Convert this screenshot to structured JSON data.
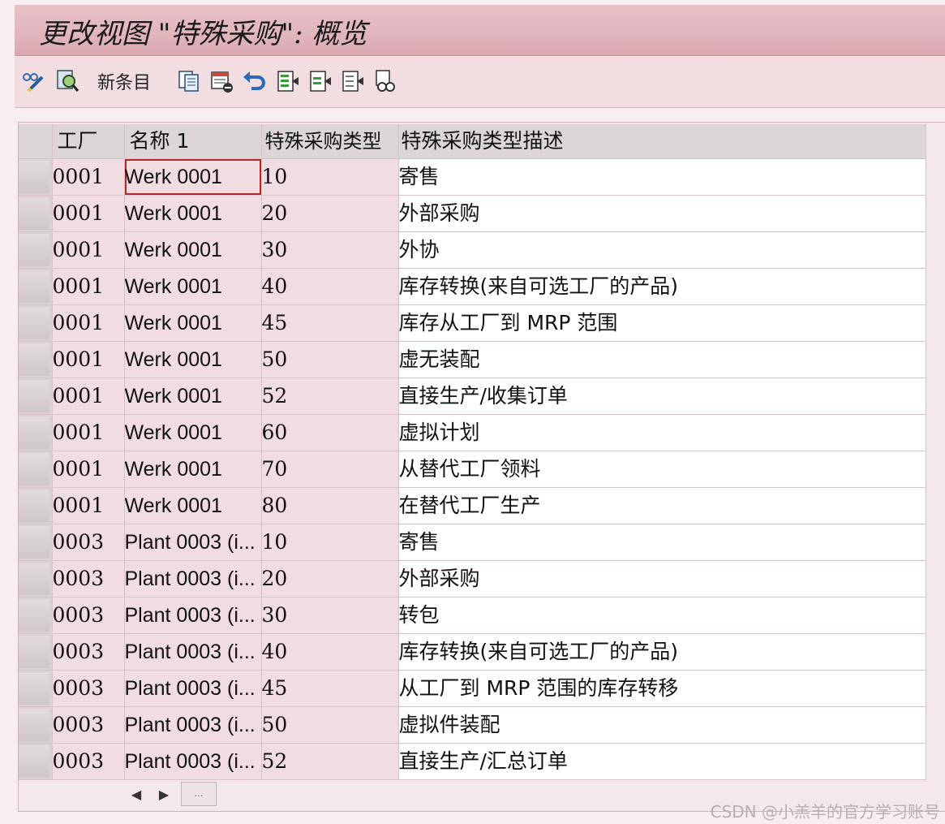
{
  "window": {
    "title": "更改视图 \"特殊采购\": 概览"
  },
  "toolbar": {
    "new_entry_label": "新条目",
    "icons": [
      "display-change-icon",
      "find-icon",
      "copy-icon",
      "delete-icon",
      "undo-icon",
      "select-all-icon",
      "select-block-icon",
      "deselect-all-icon",
      "print-icon"
    ]
  },
  "table": {
    "columns": [
      "工厂",
      "名称 1",
      "特殊采购类型",
      "特殊采购类型描述"
    ],
    "rows": [
      {
        "plant": "0001",
        "name": "Werk 0001",
        "type": "10",
        "desc": "寄售"
      },
      {
        "plant": "0001",
        "name": "Werk 0001",
        "type": "20",
        "desc": "外部采购"
      },
      {
        "plant": "0001",
        "name": "Werk 0001",
        "type": "30",
        "desc": "外协"
      },
      {
        "plant": "0001",
        "name": "Werk 0001",
        "type": "40",
        "desc": "库存转换(来自可选工厂的产品)"
      },
      {
        "plant": "0001",
        "name": "Werk 0001",
        "type": "45",
        "desc": "库存从工厂到 MRP 范围"
      },
      {
        "plant": "0001",
        "name": "Werk 0001",
        "type": "50",
        "desc": "虚无装配"
      },
      {
        "plant": "0001",
        "name": "Werk 0001",
        "type": "52",
        "desc": "直接生产/收集订单"
      },
      {
        "plant": "0001",
        "name": "Werk 0001",
        "type": "60",
        "desc": "虚拟计划"
      },
      {
        "plant": "0001",
        "name": "Werk 0001",
        "type": "70",
        "desc": "从替代工厂领料"
      },
      {
        "plant": "0001",
        "name": "Werk 0001",
        "type": "80",
        "desc": "在替代工厂生产"
      },
      {
        "plant": "0003",
        "name": "Plant 0003 (i...",
        "type": "10",
        "desc": "寄售"
      },
      {
        "plant": "0003",
        "name": "Plant 0003 (i...",
        "type": "20",
        "desc": "外部采购"
      },
      {
        "plant": "0003",
        "name": "Plant 0003 (i...",
        "type": "30",
        "desc": "转包"
      },
      {
        "plant": "0003",
        "name": "Plant 0003 (i...",
        "type": "40",
        "desc": "库存转换(来自可选工厂的产品)"
      },
      {
        "plant": "0003",
        "name": "Plant 0003 (i...",
        "type": "45",
        "desc": "从工厂到 MRP 范围的库存转移"
      },
      {
        "plant": "0003",
        "name": "Plant 0003 (i...",
        "type": "50",
        "desc": "虚拟件装配"
      },
      {
        "plant": "0003",
        "name": "Plant 0003 (i...",
        "type": "52",
        "desc": "直接生产/汇总订单"
      }
    ]
  },
  "scrollbar": {
    "thumb_label": "..."
  },
  "watermark": "CSDN @小羔羊的官方学习账号"
}
